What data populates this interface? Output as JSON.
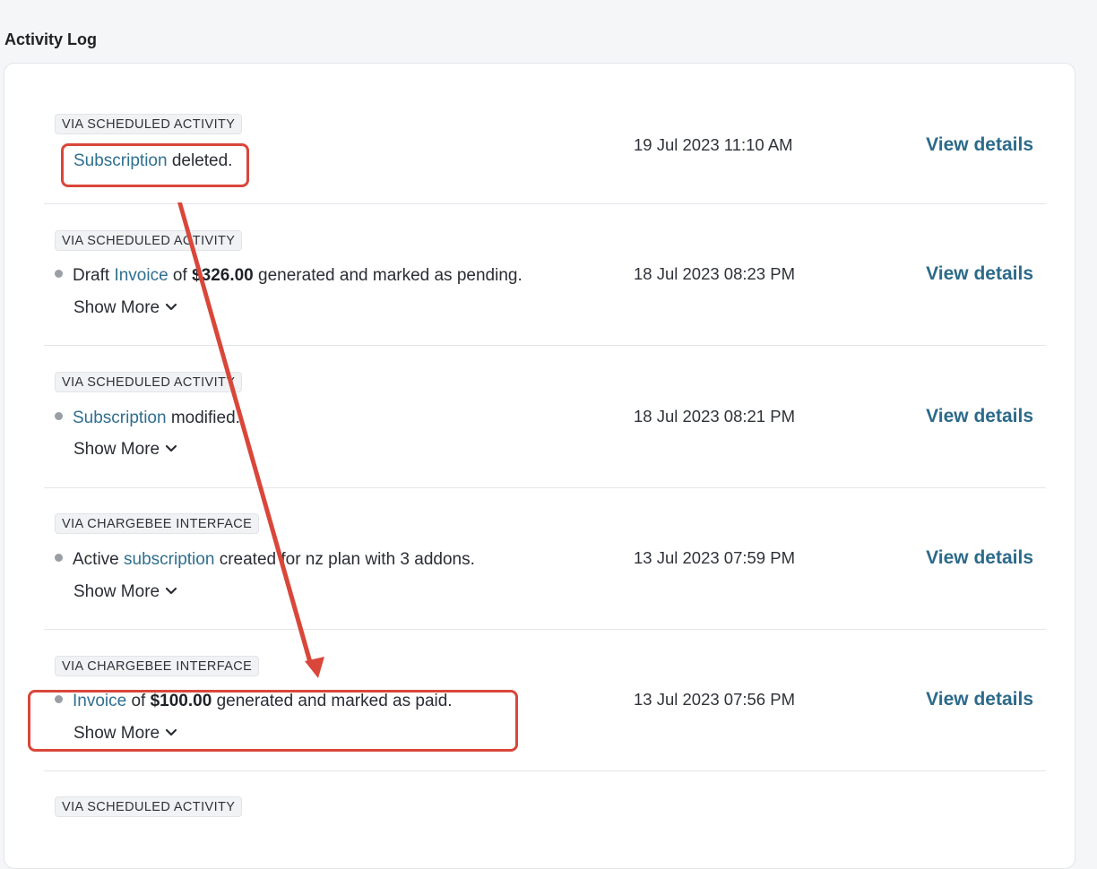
{
  "page": {
    "section_title": "Activity Log"
  },
  "activities": [
    {
      "source": "VIA SCHEDULED ACTIVITY",
      "has_bullet": false,
      "desc": {
        "pre": "",
        "link": "Subscription",
        "mid": " deleted.",
        "amount": "",
        "post": ""
      },
      "show_more": "",
      "timestamp": "19 Jul 2023 11:10 AM",
      "action": "View details"
    },
    {
      "source": "VIA SCHEDULED ACTIVITY",
      "has_bullet": true,
      "desc": {
        "pre": "Draft ",
        "link": "Invoice",
        "mid": " of ",
        "amount": "$326.00",
        "post": " generated and marked as pending."
      },
      "show_more": "Show More",
      "timestamp": "18 Jul 2023 08:23 PM",
      "action": "View details"
    },
    {
      "source": "VIA SCHEDULED ACTIVITY",
      "has_bullet": true,
      "desc": {
        "pre": "",
        "link": "Subscription",
        "mid": " modified.",
        "amount": "",
        "post": ""
      },
      "show_more": "Show More",
      "timestamp": "18 Jul 2023 08:21 PM",
      "action": "View details"
    },
    {
      "source": "VIA CHARGEBEE INTERFACE",
      "has_bullet": true,
      "desc": {
        "pre": "Active ",
        "link": "subscription",
        "mid": " created for nz plan with 3 addons.",
        "amount": "",
        "post": ""
      },
      "show_more": "Show More",
      "timestamp": "13 Jul 2023 07:59 PM",
      "action": "View details"
    },
    {
      "source": "VIA CHARGEBEE INTERFACE",
      "has_bullet": true,
      "desc": {
        "pre": "",
        "link": "Invoice",
        "mid": " of ",
        "amount": "$100.00",
        "post": " generated and marked as paid."
      },
      "show_more": "Show More",
      "timestamp": "13 Jul 2023 07:56 PM",
      "action": "View details"
    },
    {
      "source": "VIA SCHEDULED ACTIVITY",
      "has_bullet": false,
      "desc": {
        "pre": "",
        "link": "",
        "mid": "",
        "amount": "",
        "post": ""
      },
      "show_more": "",
      "timestamp": "",
      "action": ""
    }
  ],
  "annotation": {
    "color": "#d9473a"
  },
  "colors": {
    "link": "#2f6f8f",
    "action": "#2c6a8a",
    "bullet": "#9a9ea6"
  }
}
